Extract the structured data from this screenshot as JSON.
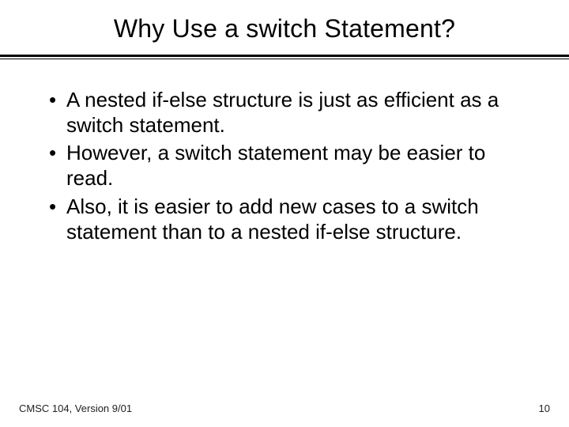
{
  "title": "Why Use a switch Statement?",
  "bullets": [
    "A nested if-else structure is just as efficient as a switch statement.",
    "However, a switch statement may be easier to read.",
    "Also, it is easier to add new cases to a switch statement than to a nested if-else structure."
  ],
  "footer": {
    "left": "CMSC 104, Version 9/01",
    "right": "10"
  }
}
